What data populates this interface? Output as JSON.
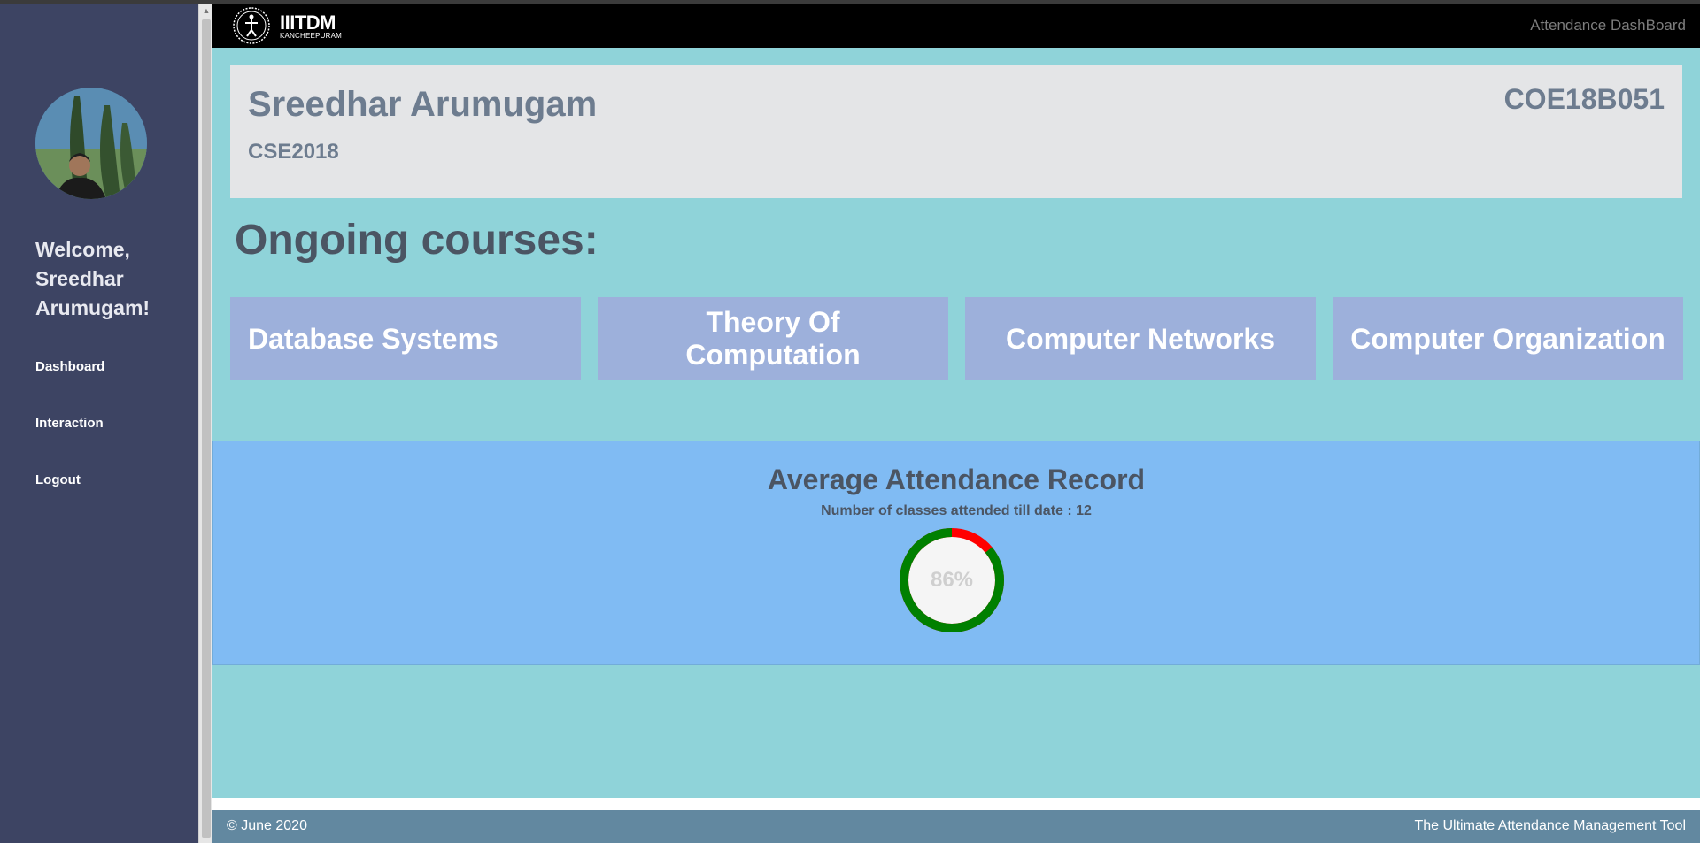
{
  "sidebar": {
    "welcome": "Welcome, Sreedhar Arumugam!",
    "nav": [
      {
        "label": "Dashboard"
      },
      {
        "label": "Interaction"
      },
      {
        "label": "Logout"
      }
    ]
  },
  "navbar": {
    "logo_name": "IIITDM",
    "logo_sub": "KANCHEEPURAM",
    "title": "Attendance DashBoard"
  },
  "profile": {
    "name": "Sreedhar Arumugam",
    "batch": "CSE2018",
    "roll_no": "COE18B051"
  },
  "courses": {
    "heading": "Ongoing courses:",
    "items": [
      {
        "label": "Database Systems"
      },
      {
        "label": "Theory Of Computation"
      },
      {
        "label": "Computer Networks"
      },
      {
        "label": "Computer Organization"
      }
    ]
  },
  "attendance": {
    "title": "Average Attendance Record",
    "classes_text": "Number of classes attended till date : 12",
    "percent_label": "86%",
    "percent": 86,
    "colors": {
      "attended": "#008000",
      "missed": "#ff0000"
    }
  },
  "footer": {
    "left": "© June 2020",
    "right": "The Ultimate Attendance Management Tool"
  }
}
